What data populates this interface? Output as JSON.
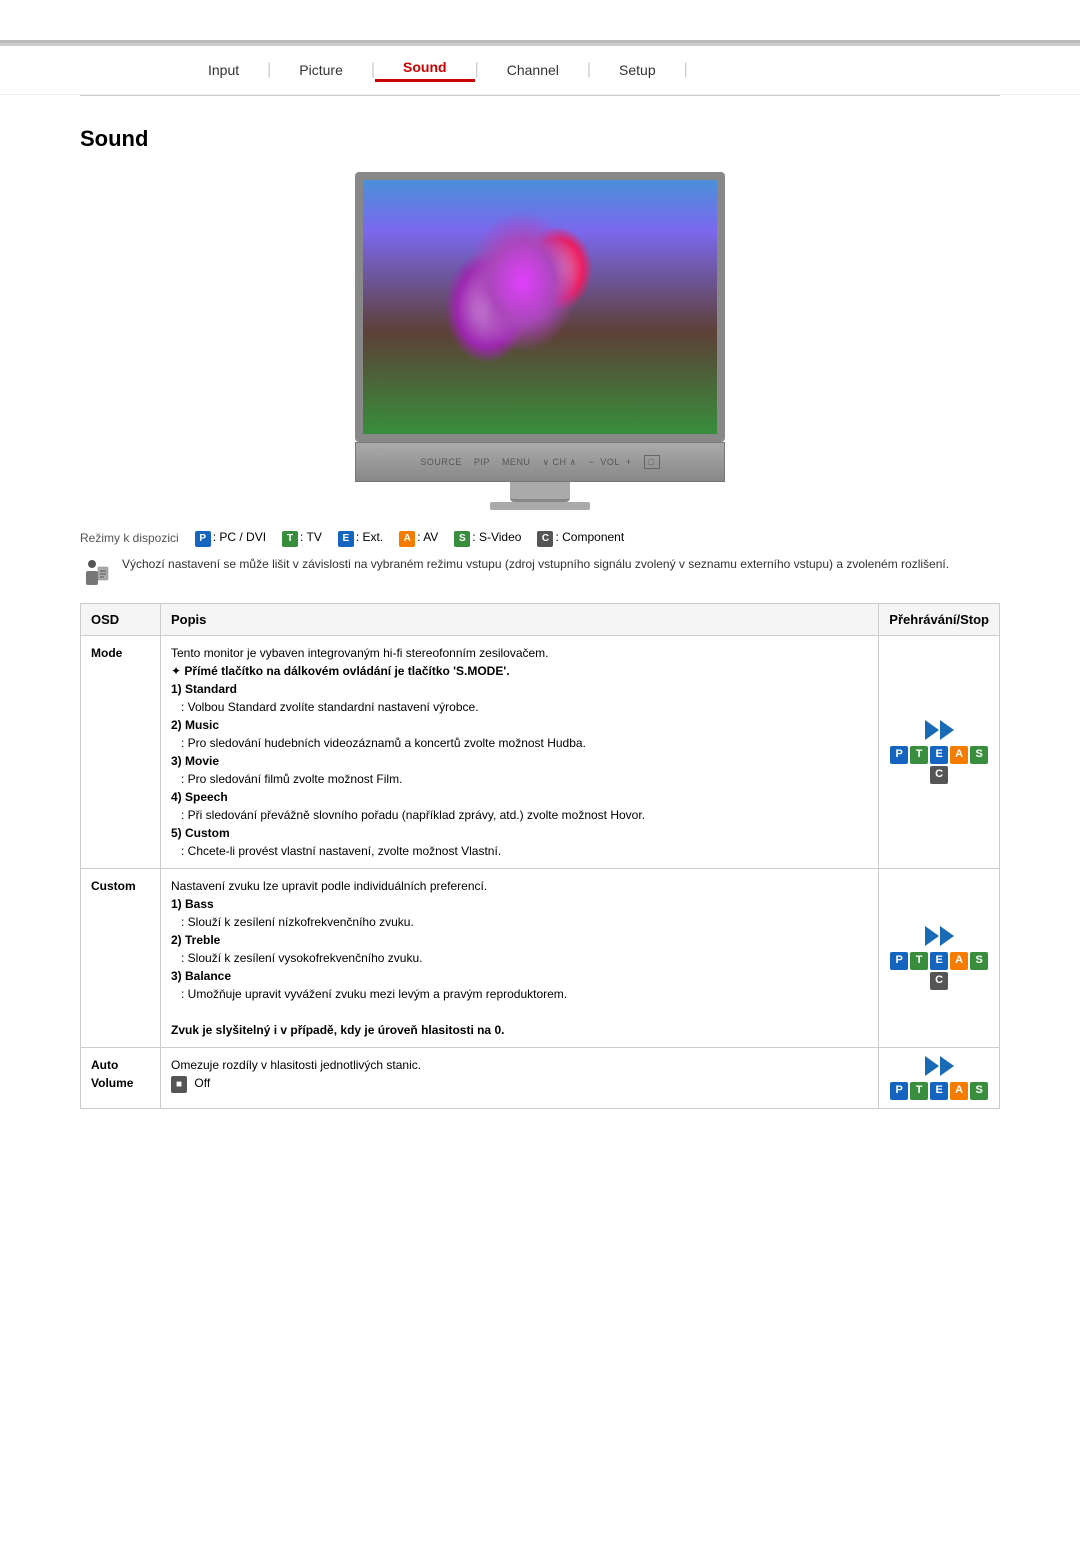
{
  "nav": {
    "items": [
      {
        "label": "Input",
        "active": false
      },
      {
        "label": "Picture",
        "active": false
      },
      {
        "label": "Sound",
        "active": true
      },
      {
        "label": "Channel",
        "active": false
      },
      {
        "label": "Setup",
        "active": false
      }
    ]
  },
  "page": {
    "title": "Sound"
  },
  "monitor": {
    "buttons": [
      "SOURCE",
      "PIP",
      "MENU",
      "∨ CH ∧",
      "−  VOL  +",
      "□"
    ]
  },
  "modes": {
    "label": "Režimy k dispozici",
    "items": [
      {
        "badge": "P",
        "text": ": PC / DVI",
        "class": "badge-p"
      },
      {
        "badge": "T",
        "text": ": TV",
        "class": "badge-t"
      },
      {
        "badge": "E",
        "text": ": Ext.",
        "class": "badge-e"
      },
      {
        "badge": "A",
        "text": ": AV",
        "class": "badge-a"
      },
      {
        "badge": "S",
        "text": ": S-Video",
        "class": "badge-s"
      },
      {
        "badge": "C",
        "text": ": Component",
        "class": "badge-c"
      }
    ]
  },
  "note": {
    "text": "Výchozí nastavení se může lišit v závislosti na vybraném režimu vstupu (zdroj vstupního signálu zvolený v seznamu externího vstupu) a zvoleném rozlišení."
  },
  "table": {
    "headers": [
      "OSD",
      "Popis",
      "Přehrávání/Stop"
    ],
    "rows": [
      {
        "osd": "Mode",
        "content_lines": [
          "Tento monitor je vybaven integrovaným hi-fi stereofonním zesilovačem.",
          "✦ Přímé tlačítko na dálkovém ovládání je tlačítko 'S.MODE'.",
          "1) Standard",
          "   : Volbou Standard zvolíte standardní nastavení výrobce.",
          "2) Music",
          "   : Pro sledování hudebních videozáznamů a koncertů zvolte možnost Hudba.",
          "3) Movie",
          "   : Pro sledování filmů zvolte možnost Film.",
          "4) Speech",
          "   : Při sledování převážně slovního pořadu (například zprávy, atd.) zvolte možnost Hovor.",
          "5) Custom",
          "   : Chcete-li provést vlastní nastavení, zvolte možnost Vlastní."
        ],
        "badges": [
          "P",
          "T",
          "E",
          "A",
          "S",
          "C"
        ]
      },
      {
        "osd": "Custom",
        "content_lines": [
          "Nastavení zvuku lze upravit podle individuálních preferencí.",
          "1) Bass",
          "   : Slouží k zesílení nízkofrekvenčního zvuku.",
          "2) Treble",
          "   : Slouží k zesílení vysokofrekvenčního zvuku.",
          "3) Balance",
          "   : Umožňuje upravit vyvážení zvuku mezi levým a pravým reproduktorem.",
          "",
          "Zvuk je slyšitelný i v případě, kdy je úroveň hlasitosti na 0."
        ],
        "badges": [
          "P",
          "T",
          "E",
          "A",
          "S",
          "C"
        ]
      },
      {
        "osd": "Auto\nVolume",
        "content_lines": [
          "Omezuje rozdíly v hlasitosti jednotlivých stanic.",
          "■ Off"
        ],
        "badges": [
          "P",
          "T",
          "E",
          "A",
          "S"
        ]
      }
    ]
  }
}
